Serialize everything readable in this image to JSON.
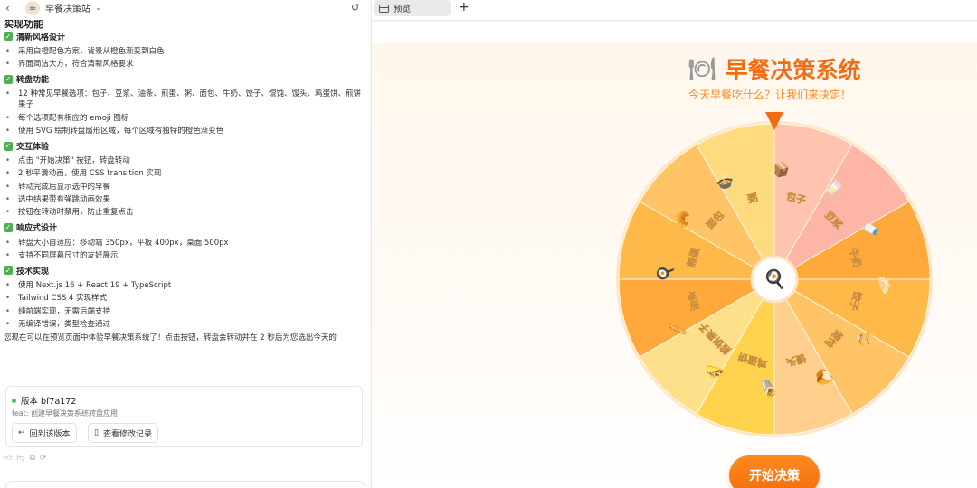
{
  "left_header": {
    "title": "早餐决策站",
    "logo": "☕"
  },
  "cut_heading": "实现功能",
  "sections": [
    {
      "title": "清新风格设计",
      "items": [
        "采用白橙配色方案，背景从橙色渐变到白色",
        "界面简洁大方，符合清新风格要求"
      ]
    },
    {
      "title": "转盘功能",
      "items": [
        "12 种常见早餐选项：包子、豆浆、油条、煎蛋、粥、面包、牛奶、饺子、馄饨、馒头、鸡蛋饼、煎饼果子",
        "每个选项配有相应的 emoji 图标",
        "使用 SVG 绘制转盘扇形区域，每个区域有独特的橙色渐变色"
      ]
    },
    {
      "title": "交互体验",
      "items": [
        "点击 \"开始决策\" 按钮，转盘转动",
        "2 秒平滑动画，使用 CSS transition 实现",
        "转动完成后显示选中的早餐",
        "选中结果带有弹跳动画效果",
        "按钮在转动时禁用，防止重复点击"
      ]
    },
    {
      "title": "响应式设计",
      "items": [
        "转盘大小自适应：移动端 350px，平板 400px，桌面 500px",
        "支持不同屏幕尺寸的友好展示"
      ]
    },
    {
      "title": "技术实现",
      "items": [
        "使用 Next.js 16 + React 19 + TypeScript",
        "Tailwind CSS 4 实现样式",
        "纯前端实现，无需后端支持",
        "无编译错误，类型检查通过"
      ]
    }
  ],
  "summary": "您现在可以在预览页面中体验早餐决策系统了！点击按钮，转盘会转动并在 2 秒后为您选出今天的",
  "version": {
    "label": "版本 bf7a172",
    "commit": "feat: 创建早餐决策系统转盘应用",
    "revert_label": "回到该版本",
    "changes_label": "查看修改记录"
  },
  "tabs": {
    "preview_label": "预览"
  },
  "app": {
    "title": "早餐决策系统",
    "title_icon": "🍽",
    "subtitle": "今天早餐吃什么？让我们来决定！",
    "button_label": "开始决策",
    "center_icon": "🍳",
    "wheel": {
      "labels": [
        "包子",
        "豆浆",
        "牛奶",
        "饺子",
        "馄饨",
        "馒头",
        "鸡蛋饼",
        "煎饼果子",
        "油条",
        "煎蛋",
        "面包",
        "粥"
      ],
      "icons": [
        "📦",
        "🥛",
        "🍼",
        "🥟",
        "🥠",
        "🍞",
        "🌯",
        "🌮",
        "🥖",
        "🍳",
        "🥐",
        "🍲"
      ],
      "colors": [
        "#ffc4b0",
        "#fdb6a6",
        "#ffa93c",
        "#ffb948",
        "#ffc466",
        "#ffd08d",
        "#ffd34d",
        "#ffe08a",
        "#ffa93c",
        "#ffb948",
        "#ffc466",
        "#ffdb7f"
      ]
    }
  },
  "colors": {
    "accent": "#f36c14",
    "check": "#4caf50"
  }
}
